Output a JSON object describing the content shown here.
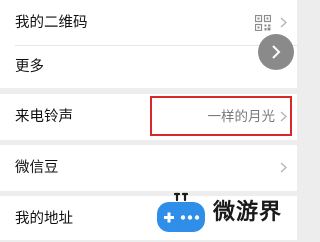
{
  "settings": {
    "rows": [
      {
        "label": "我的二维码",
        "icon": "qr-code-icon"
      },
      {
        "label": "更多"
      },
      {
        "label": "来电铃声",
        "value": "一样的月光"
      },
      {
        "label": "微信豆"
      },
      {
        "label": "我的地址"
      }
    ]
  },
  "watermark": {
    "text": "微游界",
    "logo": "gamepad-icon"
  },
  "colors": {
    "background": "#ededed",
    "row_background": "#ffffff",
    "highlight": "#d9282b",
    "watermark_blue": "#2f8fe8"
  }
}
